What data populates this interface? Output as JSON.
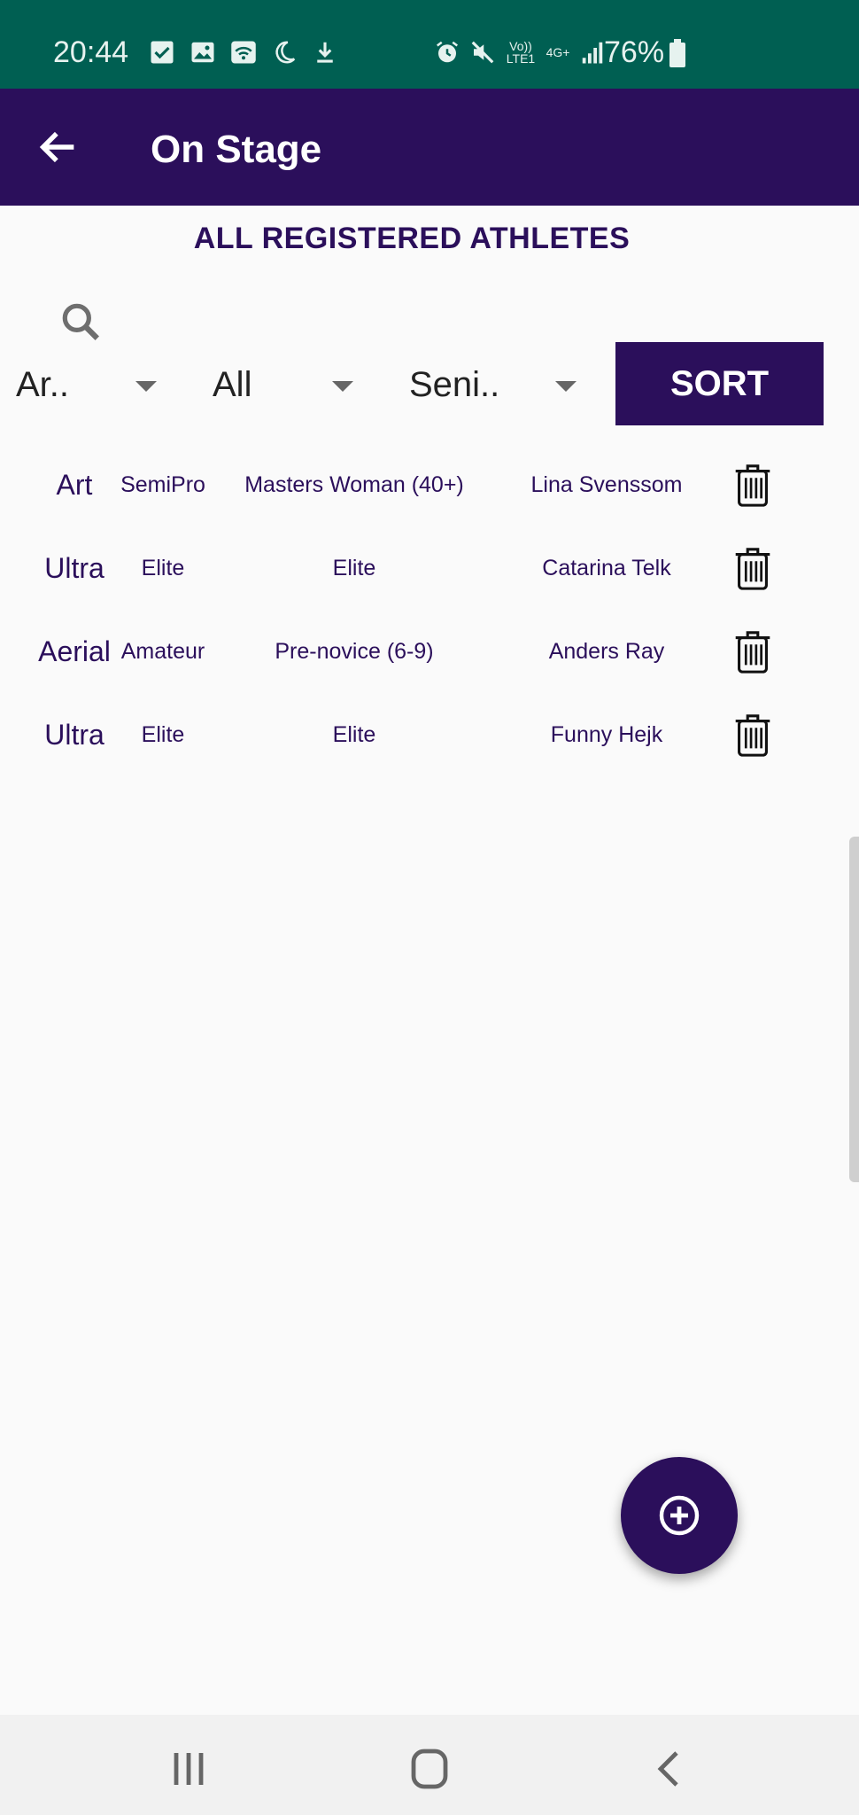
{
  "status_bar": {
    "time": "20:44",
    "network_small": [
      "Vo)) LTE1",
      "4G+"
    ],
    "battery": "76%",
    "left_icons": [
      "checkbox-icon",
      "image-icon",
      "wifi-icon",
      "moon-icon",
      "download-icon"
    ],
    "right_icons": [
      "alarm-icon",
      "mute-icon",
      "signal-icon",
      "battery-icon"
    ]
  },
  "appbar": {
    "title": "On Stage",
    "back_icon": "arrow-left-icon"
  },
  "list_title": "ALL REGISTERED ATHLETES",
  "filters": {
    "search_icon": "search-icon",
    "category": "Ar..",
    "level": "All",
    "division": "Seni..",
    "sort_label": "SORT"
  },
  "athletes": [
    {
      "category": "Art",
      "level": "SemiPro",
      "division": "Masters Woman (40+)",
      "name": "Lina Svenssom"
    },
    {
      "category": "Ultra",
      "level": "Elite",
      "division": "Elite",
      "name": "Catarina Telk"
    },
    {
      "category": "Aerial",
      "level": "Amateur",
      "division": "Pre-novice (6-9)",
      "name": "Anders Ray"
    },
    {
      "category": "Ultra",
      "level": "Elite",
      "division": "Elite",
      "name": "Funny Hejk"
    }
  ],
  "colors": {
    "status_bar": "#005f52",
    "primary": "#2b0f5b",
    "background": "#fafafa"
  },
  "fab_icon": "add-circle-icon",
  "navbar_icons": [
    "recents-icon",
    "home-icon",
    "back-icon"
  ]
}
